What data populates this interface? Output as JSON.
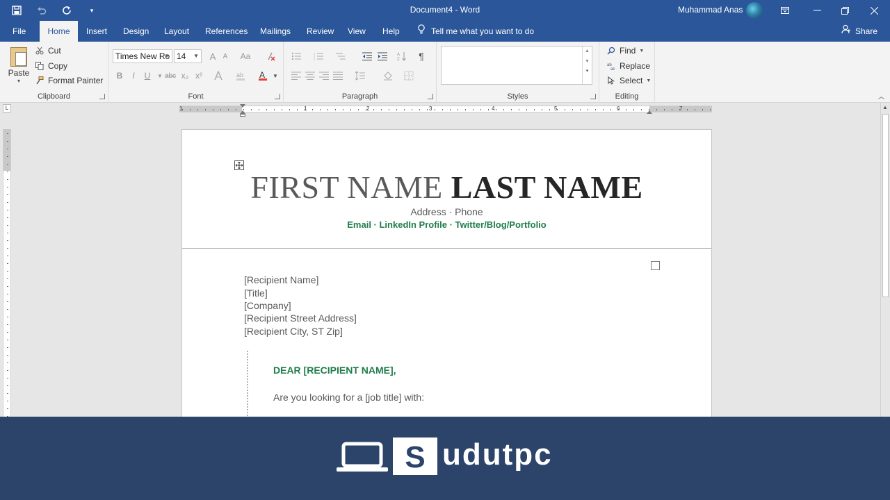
{
  "titlebar": {
    "doc_title": "Document4  -  Word",
    "user_name": "Muhammad Anas",
    "qat_icons": [
      "save-icon",
      "undo-icon",
      "redo-icon",
      "customize-qat-icon"
    ],
    "window_icons": [
      "ribbon-display-icon",
      "minimize-icon",
      "restore-icon",
      "close-icon"
    ]
  },
  "tabs": [
    "File",
    "Home",
    "Insert",
    "Design",
    "Layout",
    "References",
    "Mailings",
    "Review",
    "View",
    "Help"
  ],
  "active_tab": "Home",
  "tell_me": "Tell me what you want to do",
  "share_label": "Share",
  "ribbon": {
    "clipboard": {
      "label": "Clipboard",
      "paste": "Paste",
      "cut": "Cut",
      "copy": "Copy",
      "format_painter": "Format Painter"
    },
    "font": {
      "label": "Font",
      "font_name": "Times New Ro",
      "font_size": "14",
      "bold": "B",
      "italic": "I",
      "underline": "U",
      "strikethrough": "abc",
      "subscript": "x₂",
      "superscript": "x²",
      "grow": "A",
      "shrink": "A",
      "change_case": "Aa",
      "font_color": "A"
    },
    "paragraph": {
      "label": "Paragraph"
    },
    "styles": {
      "label": "Styles"
    },
    "editing": {
      "label": "Editing",
      "find": "Find",
      "replace": "Replace",
      "select": "Select"
    }
  },
  "ruler": {
    "tab_selector": "L",
    "numbers": [
      "1",
      "1",
      "2",
      "3",
      "4",
      "5",
      "6",
      "7"
    ]
  },
  "document": {
    "first_name": "FIRST NAME",
    "last_name": "LAST NAME",
    "address_line": "Address · Phone",
    "contact_line": "Email · LinkedIn Profile · Twitter/Blog/Portfolio",
    "recipient": [
      "[Recipient Name]",
      "[Title]",
      "[Company]",
      "[Recipient Street Address]",
      "[Recipient City, ST Zip]"
    ],
    "greeting": "DEAR [RECIPIENT NAME],",
    "body_first": "Are you looking for a [job title] with:"
  },
  "banner": {
    "brand_letter": "S",
    "brand_rest": "udutpc"
  },
  "colors": {
    "word_blue": "#2b579a",
    "accent_green": "#1e7d4a",
    "banner_bg": "#2c4469"
  }
}
